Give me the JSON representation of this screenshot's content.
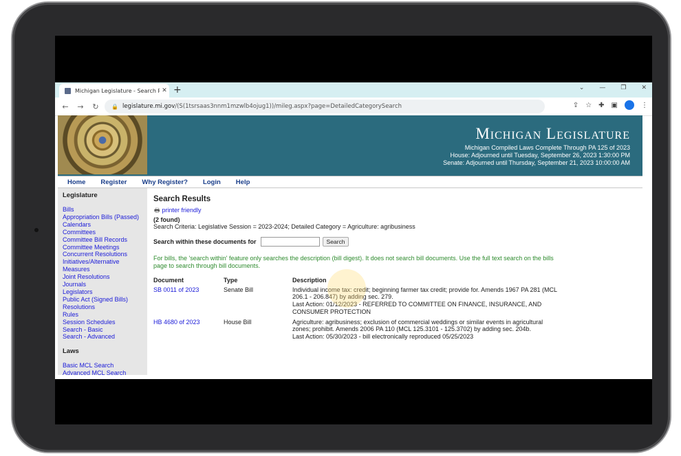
{
  "browser": {
    "tab_title": "Michigan Legislature - Search Re",
    "new_tab": "+",
    "url_host": "legislature.mi.gov",
    "url_path": "/(S(1tsrsaas3nnm1mzwlb4ojug1))/mileg.aspx?page=DetailedCategorySearch"
  },
  "banner": {
    "title": "Michigan Legislature",
    "line1": "Michigan Compiled Laws Complete Through PA 125 of 2023",
    "line2": "House: Adjourned until Tuesday, September 26, 2023 1:30:00 PM",
    "line3": "Senate: Adjourned until Thursday, September 21, 2023 10:00:00 AM"
  },
  "topnav": [
    "Home",
    "Register",
    "Why Register?",
    "Login",
    "Help"
  ],
  "sidebar": {
    "legislature_heading": "Legislature",
    "legislature_links": [
      "Bills",
      "Appropriation Bills (Passed)",
      "Calendars",
      "Committees",
      "Committee Bill Records",
      "Committee Meetings",
      "Concurrent Resolutions",
      "Initiatives/Alternative",
      "Measures",
      "Joint Resolutions",
      "Journals",
      "Legislators",
      "Public Act (Signed Bills)",
      "Resolutions",
      "Rules",
      "Session Schedules",
      "Search - Basic",
      "Search - Advanced"
    ],
    "laws_heading": "Laws",
    "laws_links": [
      "Basic MCL Search",
      "Advanced MCL Search"
    ]
  },
  "main": {
    "heading": "Search Results",
    "printer_friendly": "printer friendly",
    "found": "(2 found)",
    "criteria": "Search Criteria: Legislative Session = 2023-2024; Detailed Category = Agriculture: agribusiness",
    "search_label": "Search within these documents for",
    "search_button": "Search",
    "search_value": "",
    "note": "For bills, the 'search within' feature only searches the description (bill digest). It does not search bill documents. Use the full text search on the bills page to search through bill documents.",
    "columns": [
      "Document",
      "Type",
      "Description"
    ],
    "rows": [
      {
        "document": "SB 0011 of 2023",
        "type": "Senate Bill",
        "description": "Individual income tax: credit; beginning farmer tax credit; provide for. Amends 1967 PA 281 (MCL 206.1 - 206.847) by adding sec. 279.",
        "last_action": "Last Action: 01/12/2023 - REFERRED TO COMMITTEE ON FINANCE, INSURANCE, AND CONSUMER PROTECTION"
      },
      {
        "document": "HB 4680 of 2023",
        "type": "House Bill",
        "description": "Agriculture: agribusiness; exclusion of commercial weddings or similar events in agricultural zones; prohibit. Amends 2006 PA 110 (MCL 125.3101 - 125.3702) by adding sec. 204b.",
        "last_action": "Last Action: 05/30/2023 - bill electronically reproduced 05/25/2023"
      }
    ]
  }
}
